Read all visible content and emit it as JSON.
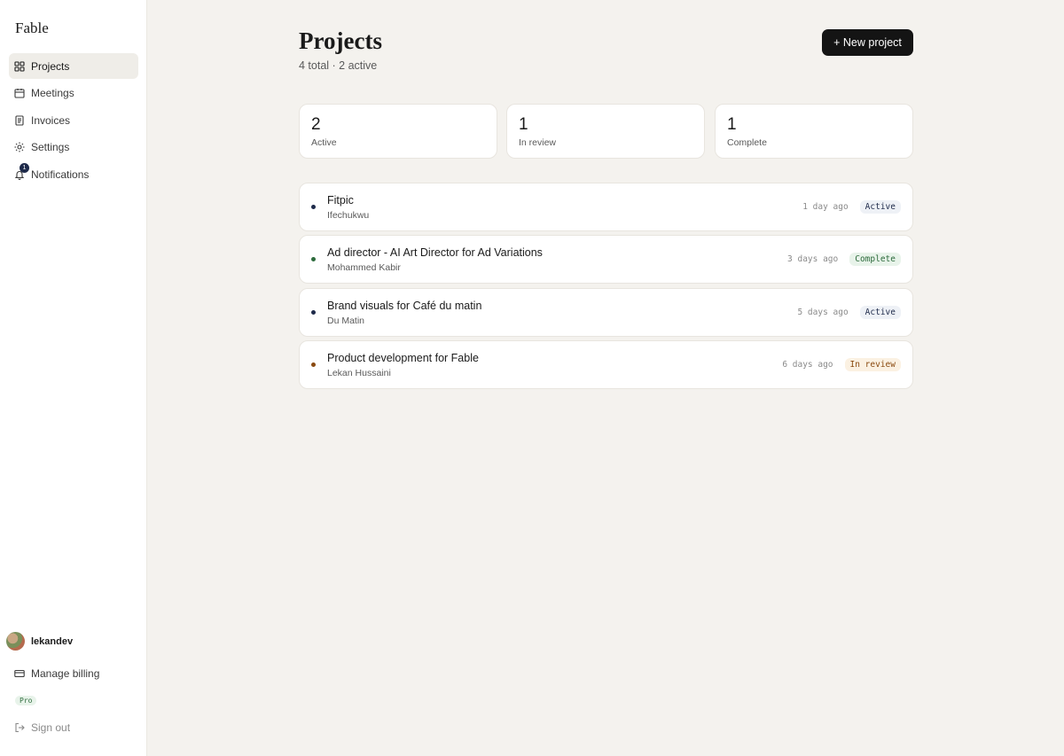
{
  "app": {
    "logo": "Fable"
  },
  "sidebar": {
    "items": [
      {
        "label": "Projects",
        "icon": "grid-icon",
        "active": true
      },
      {
        "label": "Meetings",
        "icon": "calendar-icon"
      },
      {
        "label": "Invoices",
        "icon": "document-icon"
      },
      {
        "label": "Settings",
        "icon": "sun-gear-icon"
      },
      {
        "label": "Notifications",
        "icon": "bell-icon",
        "badge": "1"
      }
    ],
    "user": {
      "name": "lekandev"
    },
    "billing_label": "Manage billing",
    "plan_badge": "Pro",
    "signout_label": "Sign out"
  },
  "header": {
    "title": "Projects",
    "subtitle": "4 total · 2 active",
    "new_button": "+ New project"
  },
  "stats": [
    {
      "value": "2",
      "label": "Active"
    },
    {
      "value": "1",
      "label": "In review"
    },
    {
      "value": "1",
      "label": "Complete"
    }
  ],
  "projects": [
    {
      "name": "Fitpic",
      "client": "Ifechukwu",
      "time": "1 day ago",
      "status": "Active",
      "dot_color": "#1e2a4a"
    },
    {
      "name": "Ad director - AI Art Director for Ad Variations",
      "client": "Mohammed Kabir",
      "time": "3 days ago",
      "status": "Complete",
      "dot_color": "#2d6b3c"
    },
    {
      "name": "Brand visuals for Café du matin",
      "client": "Du Matin",
      "time": "5 days ago",
      "status": "Active",
      "dot_color": "#1e2a4a"
    },
    {
      "name": "Product development for Fable",
      "client": "Lekan Hussaini",
      "time": "6 days ago",
      "status": "In review",
      "dot_color": "#8a4a10"
    }
  ]
}
